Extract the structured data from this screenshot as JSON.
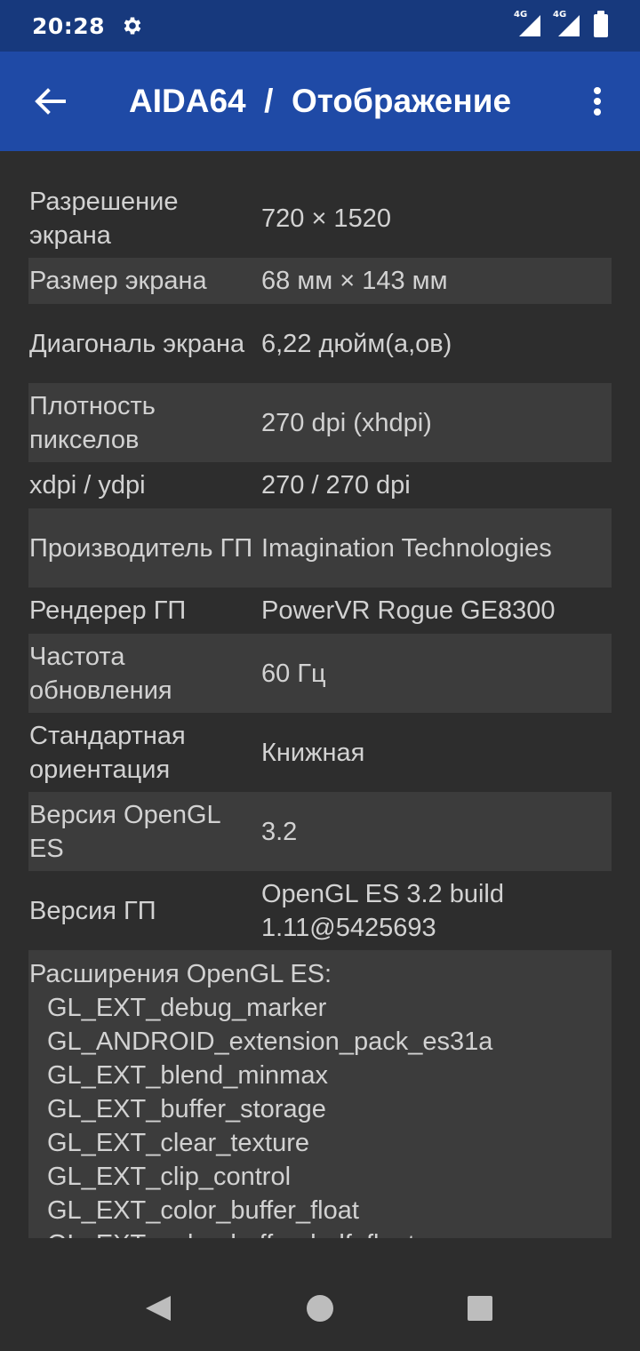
{
  "status_bar": {
    "time": "20:28",
    "icons": [
      "gear-icon",
      "signal-4g-icon",
      "signal-4g-icon",
      "battery-icon"
    ],
    "network_label_1": "4G",
    "network_label_2": "4G"
  },
  "app_bar": {
    "title": "AIDA64  /  Отображение",
    "back_icon": "arrow-left-icon",
    "menu_icon": "more-vert-icon"
  },
  "rows": [
    {
      "label": "Разрешение экрана",
      "value": "720 × 1520"
    },
    {
      "label": "Размер экрана",
      "value": "68 мм × 143 мм"
    },
    {
      "label": "Диагональ экрана",
      "value": "6,22 дюйм(а,ов)"
    },
    {
      "label": "Плотность пикселов",
      "value": "270 dpi (xhdpi)"
    },
    {
      "label": "xdpi / ydpi",
      "value": "270 / 270 dpi"
    },
    {
      "label": "Производитель ГП",
      "value": "Imagination Technologies"
    },
    {
      "label": "Рендерер ГП",
      "value": "PowerVR Rogue GE8300"
    },
    {
      "label": "Частота обновления",
      "value": "60 Гц"
    },
    {
      "label": "Стандартная ориентация",
      "value": "Книжная"
    },
    {
      "label": "Версия OpenGL ES",
      "value": "3.2"
    },
    {
      "label": "Версия ГП",
      "value": "OpenGL ES 3.2 build 1.11@5425693"
    }
  ],
  "extensions": {
    "header": "Расширения OpenGL ES:",
    "items": [
      "GL_EXT_debug_marker",
      "GL_ANDROID_extension_pack_es31a",
      "GL_EXT_blend_minmax",
      "GL_EXT_buffer_storage",
      "GL_EXT_clear_texture",
      "GL_EXT_clip_control",
      "GL_EXT_color_buffer_float",
      "GL_EXT_color_buffer_half_float"
    ]
  },
  "nav_bar": {
    "icons": [
      "nav-back-icon",
      "nav-home-icon",
      "nav-recents-icon"
    ]
  },
  "colors": {
    "status_bar": "#17397d",
    "app_bar": "#1f4aa6",
    "background": "#2d2d2d",
    "row_alt": "#3c3c3c",
    "text": "#d2d2d2"
  }
}
